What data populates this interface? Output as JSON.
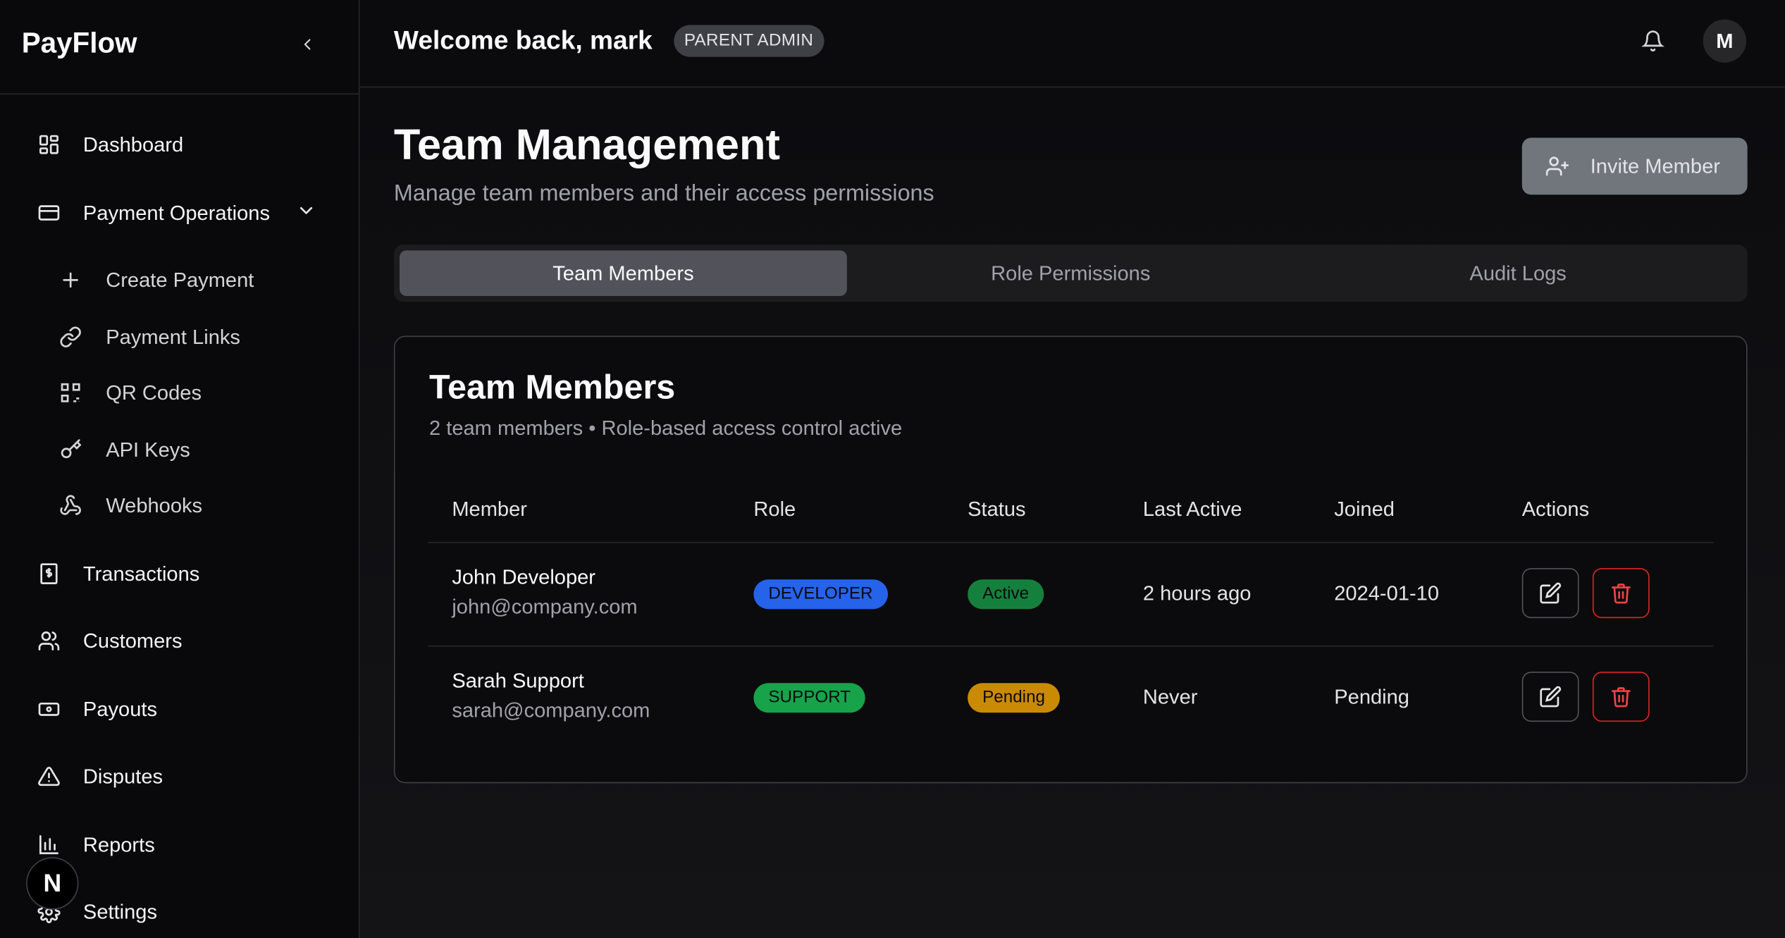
{
  "sidebar": {
    "brand": "PayFlow",
    "items": [
      {
        "label": "Dashboard",
        "icon": "dashboard-grid-icon"
      },
      {
        "label": "Payment Operations",
        "icon": "credit-card-icon"
      },
      {
        "label": "Transactions",
        "icon": "receipt-icon"
      },
      {
        "label": "Customers",
        "icon": "users-icon"
      },
      {
        "label": "Payouts",
        "icon": "banknote-icon"
      },
      {
        "label": "Disputes",
        "icon": "alert-triangle-icon"
      },
      {
        "label": "Reports",
        "icon": "bar-chart-icon"
      },
      {
        "label": "Settings",
        "icon": "gear-icon"
      }
    ],
    "sub_items": [
      {
        "label": "Create Payment",
        "icon": "plus-icon"
      },
      {
        "label": "Payment Links",
        "icon": "link-icon"
      },
      {
        "label": "QR Codes",
        "icon": "qr-code-icon"
      },
      {
        "label": "API Keys",
        "icon": "key-icon"
      },
      {
        "label": "Webhooks",
        "icon": "webhook-icon"
      }
    ],
    "dev_badge": "N"
  },
  "header": {
    "welcome": "Welcome back, mark",
    "role_badge": "PARENT ADMIN",
    "avatar_initial": "M"
  },
  "main": {
    "title": "Team Management",
    "subtitle": "Manage team members and their access permissions",
    "invite_label": "Invite Member",
    "tabs": [
      {
        "label": "Team Members",
        "active": true
      },
      {
        "label": "Role Permissions",
        "active": false
      },
      {
        "label": "Audit Logs",
        "active": false
      }
    ]
  },
  "card": {
    "title": "Team Members",
    "subtitle": "2 team members • Role-based access control active",
    "columns": [
      "Member",
      "Role",
      "Status",
      "Last Active",
      "Joined",
      "Actions"
    ],
    "rows": [
      {
        "name": "John Developer",
        "email": "john@company.com",
        "role": "DEVELOPER",
        "status": "Active",
        "last_active": "2 hours ago",
        "joined": "2024-01-10"
      },
      {
        "name": "Sarah Support",
        "email": "sarah@company.com",
        "role": "SUPPORT",
        "status": "Pending",
        "last_active": "Never",
        "joined": "Pending"
      }
    ]
  },
  "colors": {
    "developer_badge": "#2563eb",
    "support_badge": "#16a34a",
    "active_badge": "#15803d",
    "pending_badge": "#ca8a04",
    "delete_red": "#dc2626"
  }
}
